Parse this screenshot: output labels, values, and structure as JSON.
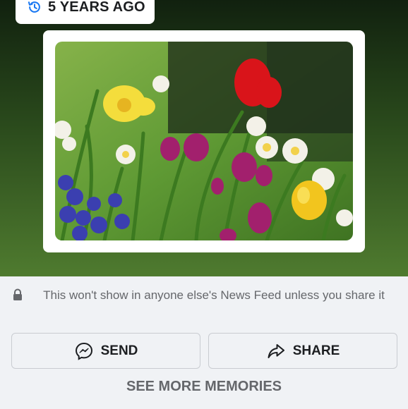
{
  "memory_badge": {
    "icon": "clock-history-icon",
    "label": "5 YEARS AGO"
  },
  "photo": {
    "subject": "tulips-and-daffodils-photo"
  },
  "privacy": {
    "icon": "lock-icon",
    "text": "This won't show in anyone else's News Feed unless you share it"
  },
  "actions": {
    "send": {
      "icon": "messenger-icon",
      "label": "SEND"
    },
    "share": {
      "icon": "share-arrow-icon",
      "label": "SHARE"
    }
  },
  "see_more": {
    "label": "SEE MORE MEMORIES"
  },
  "colors": {
    "accent": "#1877f2",
    "text_primary": "#1c1e21",
    "text_secondary": "#65676b",
    "panel": "#f0f2f5"
  }
}
